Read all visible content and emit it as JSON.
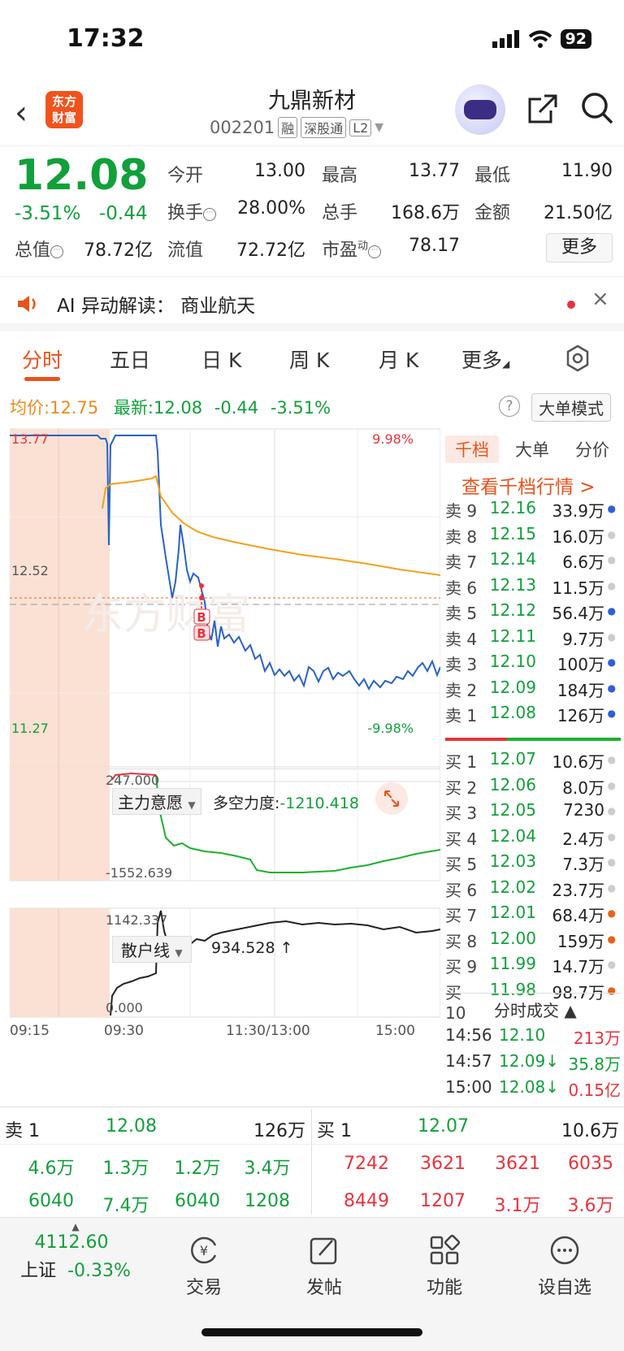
{
  "status": {
    "time": "17:32",
    "battery": "92"
  },
  "header": {
    "logo": "东方财富",
    "stock_name": "九鼎新材",
    "stock_code": "002201",
    "tags": [
      "融",
      "深股通",
      "L2"
    ]
  },
  "quote": {
    "price": "12.08",
    "pct": "-3.51%",
    "change": "-0.44",
    "cells": [
      {
        "label": "今开",
        "value": "13.00"
      },
      {
        "label": "最高",
        "value": "13.77"
      },
      {
        "label": "最低",
        "value": "11.90"
      },
      {
        "label": "换手",
        "value": "28.00%"
      },
      {
        "label": "总手",
        "value": "168.6万"
      },
      {
        "label": "金额",
        "value": "21.50亿"
      },
      {
        "label": "总值",
        "value": "78.72亿"
      },
      {
        "label": "流值",
        "value": "72.72亿"
      },
      {
        "label": "市盈",
        "sup": "动",
        "value": "78.17"
      }
    ],
    "more": "更多"
  },
  "ai": {
    "text": "AI 异动解读：  商业航天"
  },
  "tabs": [
    "分时",
    "五日",
    "日 K",
    "周 K",
    "月 K",
    "更多"
  ],
  "info": {
    "avg_label": "均价:",
    "avg": "12.75",
    "latest_label": "最新:",
    "latest": "12.08",
    "latest_chg": "-0.44",
    "latest_pct": "-3.51%",
    "big_order": "大单模式"
  },
  "chart": {
    "y_top": "13.77",
    "y_mid": "12.52",
    "y_bot": "11.27",
    "pct_top": "9.98%",
    "pct_bot": "-9.98%",
    "markers": [
      "B",
      "B"
    ],
    "watermark": "东方财富",
    "ind1_label": "主力意愿",
    "ind1_title": "多空力度:",
    "ind1_value": "-1210.418",
    "ind1_top": "247.000",
    "ind1_bot": "-1552.639",
    "ind2_label": "散户线",
    "ind2_value": "934.528 ↑",
    "ind2_top": "1142.337",
    "ind2_bot": "0.000",
    "x_labels": [
      "09:15",
      "09:30",
      "11:30/13:00",
      "15:00"
    ]
  },
  "orderbook": {
    "tabs": [
      "千档",
      "大单",
      "分价"
    ],
    "link": "查看千档行情 >",
    "asks": [
      {
        "label": "卖 9",
        "price": "12.16",
        "vol": "33.9万",
        "dot": "#2f5fd8"
      },
      {
        "label": "卖 8",
        "price": "12.15",
        "vol": "16.0万",
        "dot": "#cccccc"
      },
      {
        "label": "卖 7",
        "price": "12.14",
        "vol": "6.6万",
        "dot": "#cccccc"
      },
      {
        "label": "卖 6",
        "price": "12.13",
        "vol": "11.5万",
        "dot": "#cccccc"
      },
      {
        "label": "卖 5",
        "price": "12.12",
        "vol": "56.4万",
        "dot": "#2f5fd8"
      },
      {
        "label": "卖 4",
        "price": "12.11",
        "vol": "9.7万",
        "dot": "#cccccc"
      },
      {
        "label": "卖 3",
        "price": "12.10",
        "vol": "100万",
        "dot": "#2f5fd8"
      },
      {
        "label": "卖 2",
        "price": "12.09",
        "vol": "184万",
        "dot": "#2f5fd8"
      },
      {
        "label": "卖 1",
        "price": "12.08",
        "vol": "126万",
        "dot": "#2f5fd8"
      }
    ],
    "bids": [
      {
        "label": "买 1",
        "price": "12.07",
        "vol": "10.6万",
        "dot": "#cccccc"
      },
      {
        "label": "买 2",
        "price": "12.06",
        "vol": "8.0万",
        "dot": "#cccccc"
      },
      {
        "label": "买 3",
        "price": "12.05",
        "vol": "7230",
        "dot": "#cccccc"
      },
      {
        "label": "买 4",
        "price": "12.04",
        "vol": "2.4万",
        "dot": "#cccccc"
      },
      {
        "label": "买 5",
        "price": "12.03",
        "vol": "7.3万",
        "dot": "#cccccc"
      },
      {
        "label": "买 6",
        "price": "12.02",
        "vol": "23.7万",
        "dot": "#cccccc"
      },
      {
        "label": "买 7",
        "price": "12.01",
        "vol": "68.4万",
        "dot": "#e8611c"
      },
      {
        "label": "买 8",
        "price": "12.00",
        "vol": "159万",
        "dot": "#e8611c"
      },
      {
        "label": "买 9",
        "price": "11.99",
        "vol": "14.7万",
        "dot": "#cccccc"
      },
      {
        "label": "买 10",
        "price": "11.98",
        "vol": "98.7万",
        "dot": "#e8611c"
      }
    ],
    "trades_title": "分时成交 ▲",
    "trades": [
      {
        "time": "14:56",
        "price": "12.10",
        "vol": "213万",
        "color": "#e8333c"
      },
      {
        "time": "14:57",
        "price": "12.09↓",
        "vol": "35.8万",
        "color": "#11a03a"
      },
      {
        "time": "15:00",
        "price": "12.08↓",
        "vol": "0.15亿",
        "color": "#e8333c"
      }
    ]
  },
  "bottom": {
    "sell1_label": "卖 1",
    "sell1_price": "12.08",
    "sell1_vol": "126万",
    "buy1_label": "买 1",
    "buy1_price": "12.07",
    "buy1_vol": "10.6万",
    "sell_row1": [
      "4.6万",
      "1.3万",
      "1.2万",
      "3.4万"
    ],
    "sell_row2": [
      "6040",
      "7.4万",
      "6040",
      "1208"
    ],
    "buy_row1": [
      "7242",
      "3621",
      "3621",
      "6035"
    ],
    "buy_row2": [
      "8449",
      "1207",
      "3.1万",
      "3.6万"
    ]
  },
  "nav": {
    "index_value": "4112.60",
    "index_name": "上证",
    "index_pct": "-0.33%",
    "items": [
      "交易",
      "发帖",
      "功能",
      "设自选"
    ]
  }
}
